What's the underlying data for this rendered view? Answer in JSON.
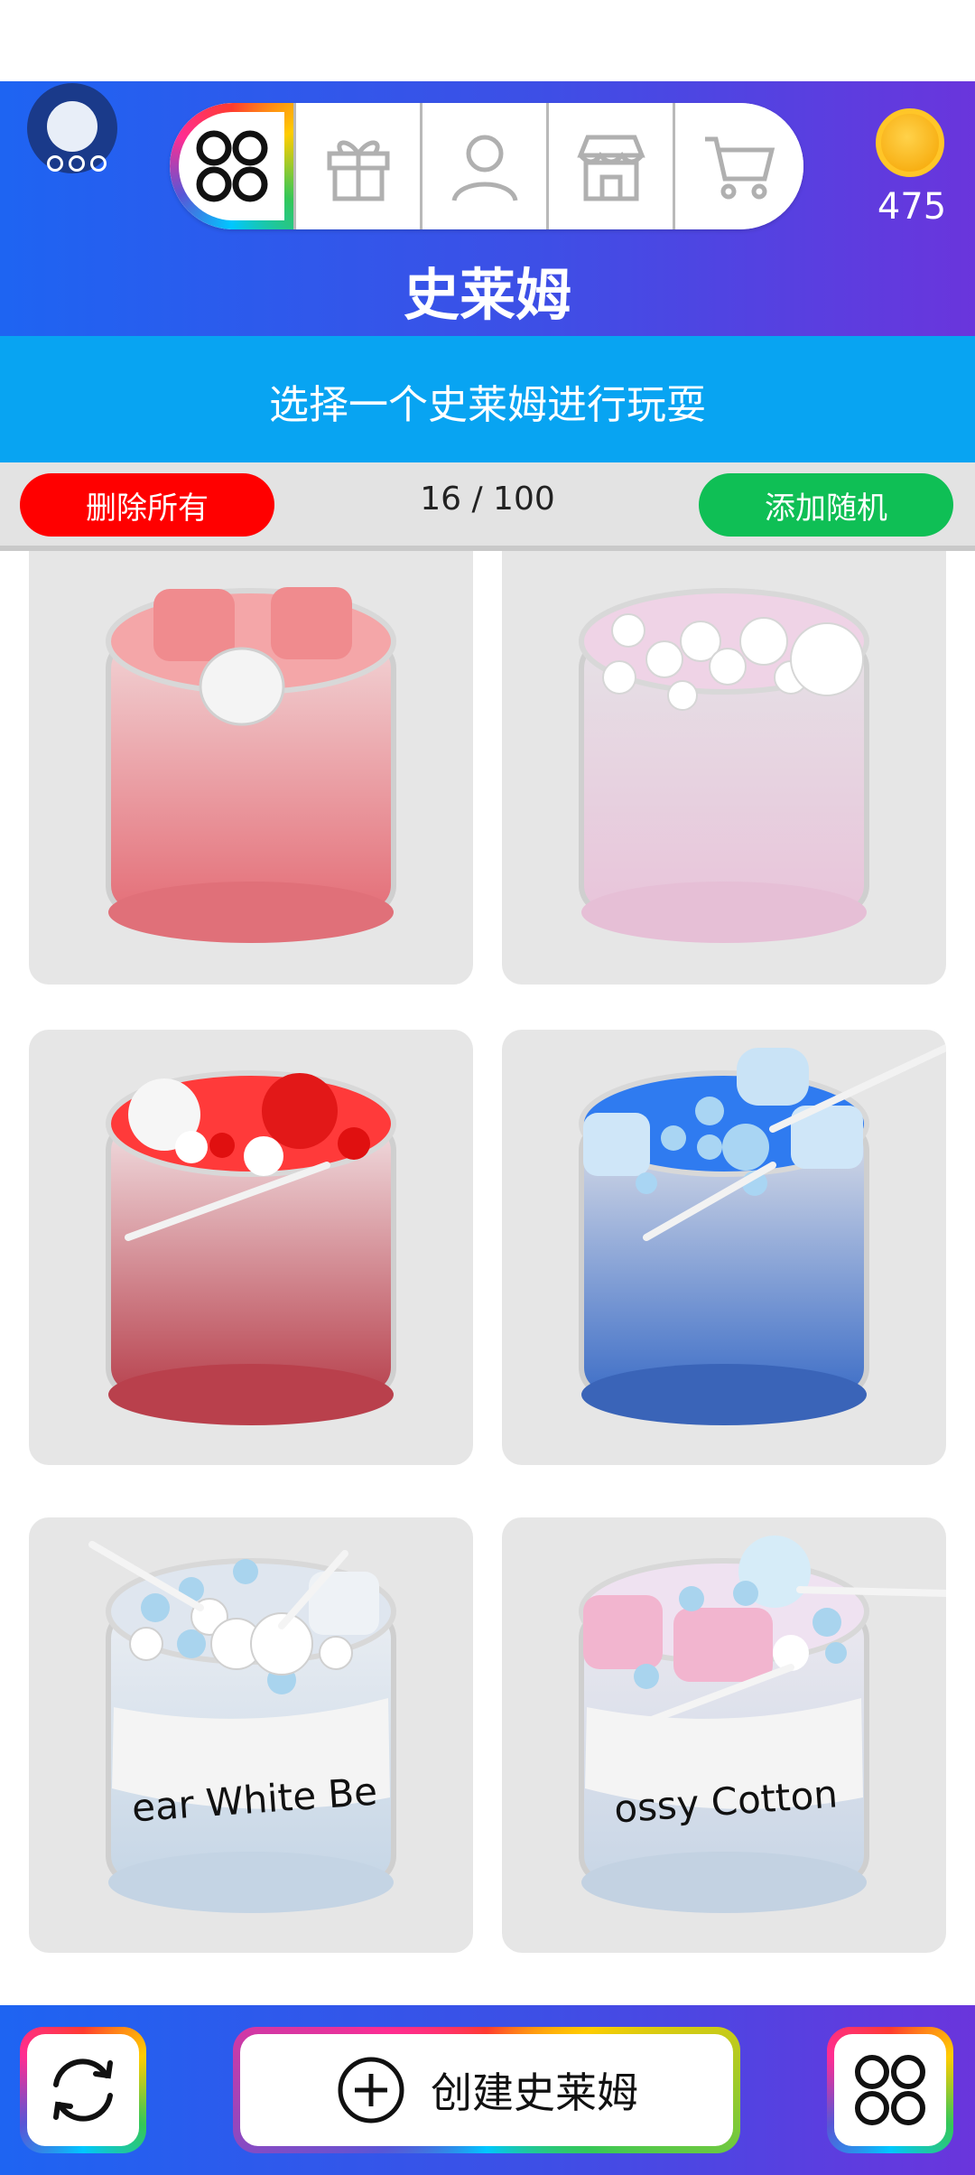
{
  "header": {
    "title": "史莱姆",
    "coins": "475",
    "nav": [
      "grid-icon",
      "gift-icon",
      "user-icon",
      "shop-icon",
      "cart-icon"
    ]
  },
  "subtitle": "选择一个史莱姆进行玩耍",
  "controls": {
    "delete_all": "删除所有",
    "counter": "16 / 100",
    "add_random": "添加随机"
  },
  "slimes": [
    {
      "label": "",
      "top_color": "#f4a6a8",
      "body_color": "#e88b90"
    },
    {
      "label": "",
      "top_color": "#efd3e6",
      "body_color": "#e8c8dd"
    },
    {
      "label": "",
      "top_color": "#ff3a3a",
      "body_color": "#c95058"
    },
    {
      "label": "",
      "top_color": "#2f7bf0",
      "body_color": "#5b7ec4"
    },
    {
      "label": "ear White Be",
      "top_color": "#dfe6ef",
      "body_color": "#d5dee9"
    },
    {
      "label": "ossy Cotton",
      "top_color": "#efe2f1",
      "body_color": "#d8dee8"
    }
  ],
  "bottom": {
    "create": "创建史莱姆"
  },
  "colors": {
    "accent_blue": "#1e64f2",
    "accent_purple": "#6a35dc",
    "sub_blue": "#08a4f2",
    "delete_red": "#ff0000",
    "add_green": "#0fbf55"
  }
}
